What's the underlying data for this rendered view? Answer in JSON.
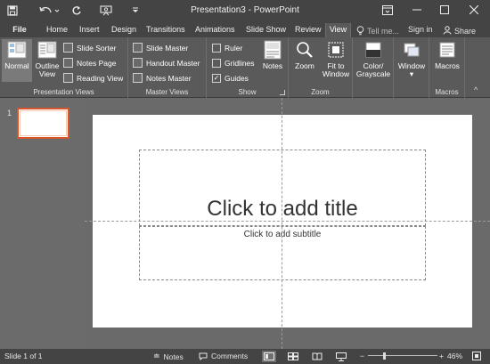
{
  "app": {
    "window_title": "Presentation3 - PowerPoint"
  },
  "tabs": [
    {
      "label": "File"
    },
    {
      "label": "Home"
    },
    {
      "label": "Insert"
    },
    {
      "label": "Design"
    },
    {
      "label": "Transitions"
    },
    {
      "label": "Animations"
    },
    {
      "label": "Slide Show"
    },
    {
      "label": "Review"
    },
    {
      "label": "View",
      "active": true
    }
  ],
  "tell_me": "Tell me...",
  "sign_in": "Sign in",
  "share": "Share",
  "ribbon": {
    "presentation_views": {
      "label": "Presentation Views",
      "normal": "Normal",
      "outline_view_1": "Outline",
      "outline_view_2": "View",
      "slide_sorter": "Slide Sorter",
      "notes_page": "Notes Page",
      "reading_view": "Reading View"
    },
    "master_views": {
      "label": "Master Views",
      "slide_master": "Slide Master",
      "handout_master": "Handout Master",
      "notes_master": "Notes Master"
    },
    "show": {
      "label": "Show",
      "ruler": "Ruler",
      "gridlines": "Gridlines",
      "guides": "Guides",
      "ruler_checked": false,
      "gridlines_checked": false,
      "guides_checked": true,
      "notes": "Notes"
    },
    "zoom": {
      "label": "Zoom",
      "zoom": "Zoom",
      "fit_1": "Fit to",
      "fit_2": "Window"
    },
    "color": {
      "color_1": "Color/",
      "color_2": "Grayscale"
    },
    "window": {
      "label": "Window"
    },
    "macros": {
      "label": "Macros",
      "button": "Macros"
    }
  },
  "thumbnail": {
    "number": "1"
  },
  "slide": {
    "title_placeholder": "Click to add title",
    "subtitle_placeholder": "Click to add subtitle"
  },
  "status": {
    "slide_count": "Slide 1 of 1",
    "notes": "Notes",
    "comments": "Comments",
    "zoom_percent": "46%",
    "zoom_level": 0.46
  },
  "colors": {
    "accent": "#d9552a",
    "ribbon": "#5a5a5a",
    "chrome": "#444444"
  }
}
